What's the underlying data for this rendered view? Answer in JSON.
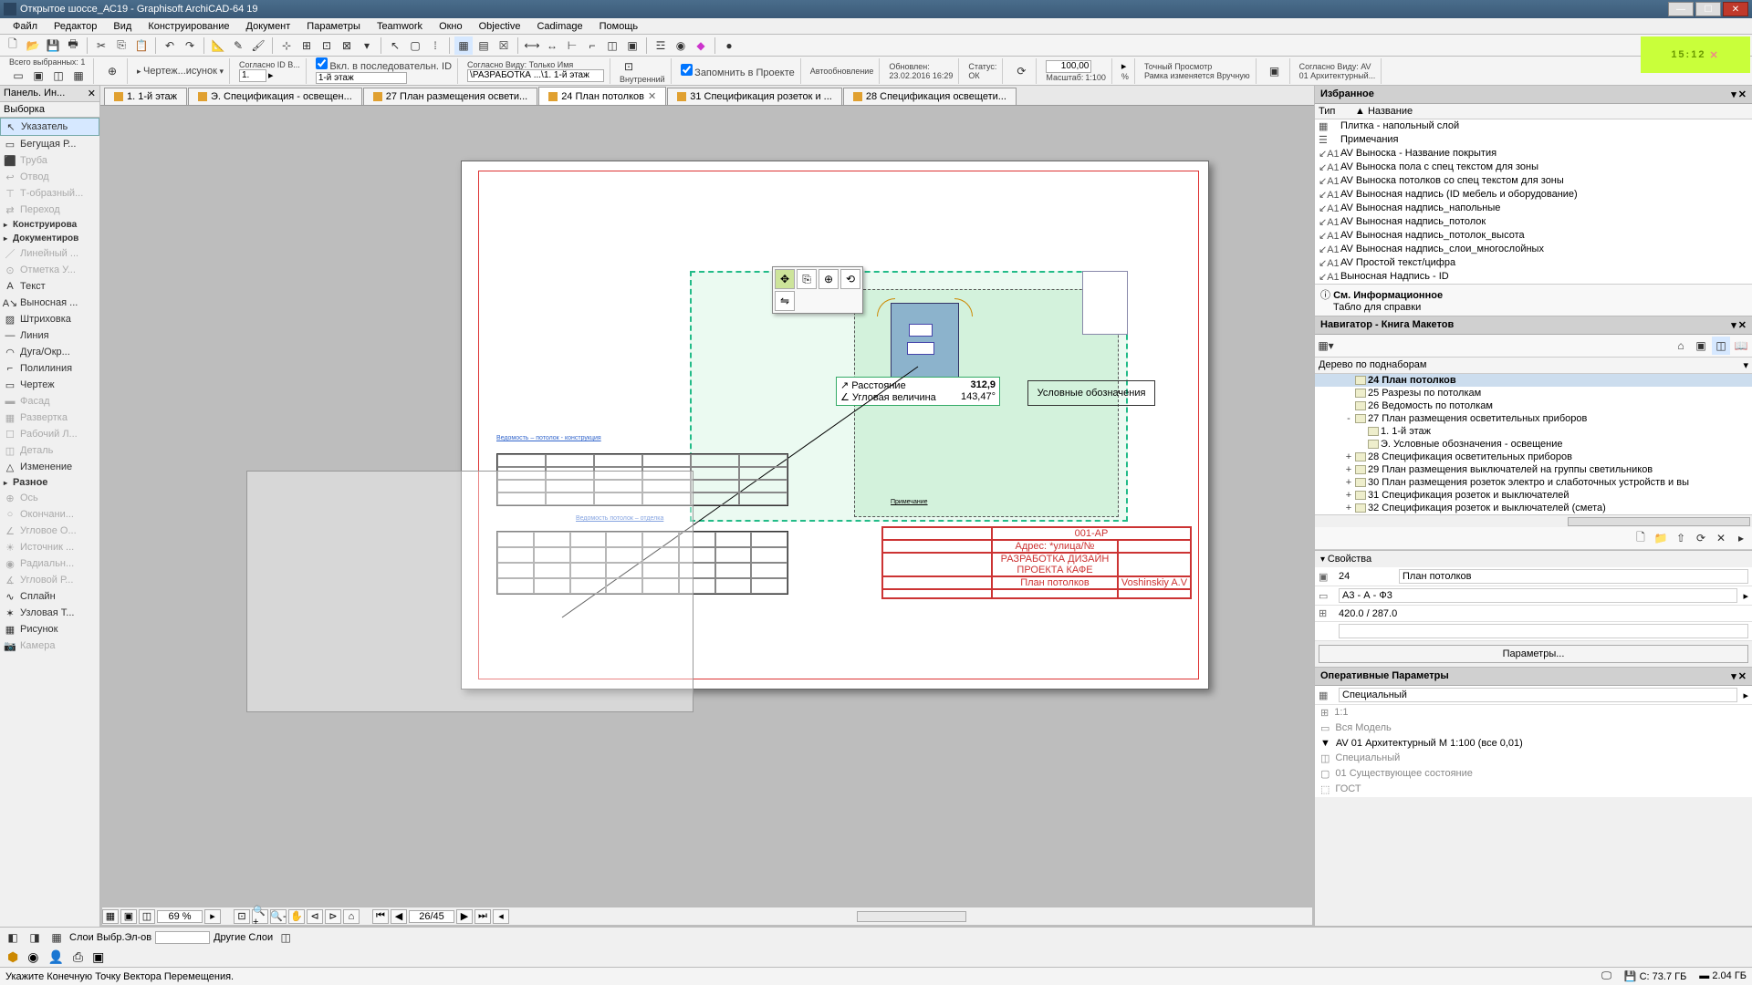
{
  "title": "Открытое шоссе_АС19 - Graphisoft ArchiCAD-64 19",
  "menu": [
    "Файл",
    "Редактор",
    "Вид",
    "Конструирование",
    "Документ",
    "Параметры",
    "Teamwork",
    "Окно",
    "Objective",
    "Cadimage",
    "Помощь"
  ],
  "clock": "15:12",
  "infobar": {
    "sel_label": "Всего выбранных: 1",
    "drawing": "Чертеж...исунок",
    "id_mode_label": "Согласно ID В...",
    "id_val": "1.",
    "seq_label": "Вкл. в последовательн. ID",
    "story": "1-й этаж",
    "view_label": "Согласно Виду: Только Имя",
    "source": "\\РАЗРАБОТКА ...\\1. 1-й этаж",
    "inner": "Внутренний",
    "save": "Запомнить в Проекте",
    "auto": "Автообновление",
    "updated_label": "Обновлен:",
    "updated_val": "23.02.2016 16:29",
    "status_label": "Статус:",
    "status_val": "ОК",
    "size_val": "100,00",
    "pct": "%",
    "scale_label": "Масштаб:",
    "scale_val": "1:100",
    "preview": "Точный Просмотр",
    "frame": "Рамка изменяется Вручную",
    "view_ref_label": "Согласно Виду: AV",
    "view_ref_val": "01 Архитектурный..."
  },
  "toolbox": {
    "title": "Панель. Ин...",
    "subtitle": "Выборка",
    "items": [
      {
        "icon": "↖",
        "label": "Указатель",
        "sel": true
      },
      {
        "icon": "▭",
        "label": "Бегущая Р...",
        "dim": false
      },
      {
        "icon": "⬛",
        "label": "Труба",
        "dim": true
      },
      {
        "icon": "↩",
        "label": "Отвод",
        "dim": true
      },
      {
        "icon": "⊤",
        "label": "Т-образный...",
        "dim": true
      },
      {
        "icon": "⇄",
        "label": "Переход",
        "dim": true
      }
    ],
    "groups": [
      {
        "label": "Конструирова",
        "tri": true
      },
      {
        "label": "Документиров",
        "tri": true
      }
    ],
    "doc_items": [
      {
        "icon": "／",
        "label": "Линейный ...",
        "dim": true
      },
      {
        "icon": "⊙",
        "label": "Отметка У...",
        "dim": true
      },
      {
        "icon": "A",
        "label": "Текст"
      },
      {
        "icon": "A↘",
        "label": "Выносная ..."
      },
      {
        "icon": "▨",
        "label": "Штриховка"
      },
      {
        "icon": "—",
        "label": "Линия"
      },
      {
        "icon": "◠",
        "label": "Дуга/Окр..."
      },
      {
        "icon": "⌐",
        "label": "Полилиния"
      },
      {
        "icon": "▭",
        "label": "Чертеж"
      },
      {
        "icon": "▬",
        "label": "Фасад",
        "dim": true
      },
      {
        "icon": "▦",
        "label": "Развертка",
        "dim": true
      },
      {
        "icon": "☐",
        "label": "Рабочий Л...",
        "dim": true
      },
      {
        "icon": "◫",
        "label": "Деталь",
        "dim": true
      },
      {
        "icon": "△",
        "label": "Изменение"
      }
    ],
    "more_group": "Разное",
    "more_items": [
      {
        "icon": "⊕",
        "label": "Ось",
        "dim": true
      },
      {
        "icon": "○",
        "label": "Окончани...",
        "dim": true
      },
      {
        "icon": "∠",
        "label": "Угловое О...",
        "dim": true
      },
      {
        "icon": "☀",
        "label": "Источник ...",
        "dim": true
      },
      {
        "icon": "◉",
        "label": "Радиальн...",
        "dim": true
      },
      {
        "icon": "∡",
        "label": "Угловой Р...",
        "dim": true
      },
      {
        "icon": "∿",
        "label": "Сплайн"
      },
      {
        "icon": "✶",
        "label": "Узловая Т..."
      },
      {
        "icon": "▦",
        "label": "Рисунок"
      },
      {
        "icon": "📷",
        "label": "Камера",
        "dim": true
      }
    ]
  },
  "tabs": [
    {
      "label": "1. 1-й этаж"
    },
    {
      "label": "Э. Спецификация - освещен..."
    },
    {
      "label": "27 План размещения освети..."
    },
    {
      "label": "24 План потолков",
      "active": true
    },
    {
      "label": "31 Спецификация розеток и ..."
    },
    {
      "label": "28 Спецификация освещети..."
    }
  ],
  "canvas_tooltip": {
    "dist": "Расстояние",
    "dist_val": "312,9",
    "ang": "Угловая величина",
    "ang_val": "143,47°"
  },
  "canvas_labels": {
    "spec1": "Ведомость – потолок - конструкция",
    "spec2": "Ведомость потолок – отделка",
    "note": "Примечание",
    "titleblock": "План потолков",
    "legend": "Условные обозначения",
    "proj": "РАЗРАБОТКА ДИЗАЙН ПРОЕКТА КАФЕ",
    "code": "001-АР",
    "auth": "Voshinskiy A.V",
    "date": "Адрес: *улица/№"
  },
  "zoom": {
    "pct": "69 %",
    "page": "26/45"
  },
  "favorites": {
    "title": "Избранное",
    "cols": [
      "Тип",
      "▲ Название"
    ],
    "rows": [
      {
        "t": "▦",
        "n": "Плитка - напольный слой"
      },
      {
        "t": "☰",
        "n": "Примечания"
      },
      {
        "t": "↙A1",
        "n": "AV Выноска - Название покрытия"
      },
      {
        "t": "↙A1",
        "n": "AV Выноска пола с спец текстом для зоны"
      },
      {
        "t": "↙A1",
        "n": "AV Выноска потолков со спец текстом для зоны"
      },
      {
        "t": "↙A1",
        "n": "AV Выносная надпись (ID мебель и оборудование)"
      },
      {
        "t": "↙A1",
        "n": "AV Выносная надпись_напольные"
      },
      {
        "t": "↙A1",
        "n": "AV Выносная надпись_потолок"
      },
      {
        "t": "↙A1",
        "n": "AV Выносная надпись_потолок_высота"
      },
      {
        "t": "↙A1",
        "n": "AV Выносная надпись_слои_многослойных"
      },
      {
        "t": "↙A1",
        "n": "AV Простой текст/цифра"
      },
      {
        "t": "↙A1",
        "n": "Выносная Надпись - ID"
      }
    ],
    "footer_title": "См. Информационное",
    "footer_sub": "Табло для справки"
  },
  "navigator": {
    "title": "Навигатор - Книга Макетов",
    "filter": "Дерево по поднаборам",
    "tree": [
      {
        "ind": 2,
        "ico": "▣",
        "label": "24 План потолков",
        "sel": true
      },
      {
        "ind": 2,
        "ico": "▣",
        "label": "25 Разрезы по потолкам"
      },
      {
        "ind": 2,
        "ico": "▣",
        "label": "26 Ведомость по потолкам"
      },
      {
        "ind": 2,
        "ico": "▣",
        "label": "27 План размещения осветительных приборов",
        "tog": "-"
      },
      {
        "ind": 3,
        "ico": "▫",
        "label": "1. 1-й этаж"
      },
      {
        "ind": 3,
        "ico": "▫",
        "label": "Э. Условные обозначения - освещение"
      },
      {
        "ind": 2,
        "ico": "▣",
        "label": "28 Спецификация осветительных приборов",
        "tog": "+"
      },
      {
        "ind": 2,
        "ico": "▣",
        "label": "29 План размещения выключателей на группы светильников",
        "tog": "+"
      },
      {
        "ind": 2,
        "ico": "▣",
        "label": "30 План размещения розеток электро и слаботочных устройств и вы",
        "tog": "+"
      },
      {
        "ind": 2,
        "ico": "▣",
        "label": "31 Спецификация розеток и выключателей",
        "tog": "+"
      },
      {
        "ind": 2,
        "ico": "▣",
        "label": "32 Спецификация розеток и выключателей (смета)",
        "tog": "+"
      }
    ]
  },
  "props": {
    "title": "Свойства",
    "id": "24",
    "name": "План потолков",
    "format": "А3 - А - Ф3",
    "dims": "420.0 / 287.0",
    "param_btn": "Параметры..."
  },
  "oper": {
    "title": "Оперативные Параметры",
    "combo": "Специальный",
    "rows": [
      {
        "t": "⊞",
        "n": "1:1",
        "dim": true
      },
      {
        "t": "▭",
        "n": "Вся Модель",
        "dim": true
      },
      {
        "t": "▼",
        "n": "AV 01 Архитектурный М 1:100 (все 0,01)"
      },
      {
        "t": "◫",
        "n": "Специальный",
        "dim": true
      },
      {
        "t": "▢",
        "n": "01 Существующее состояние",
        "dim": true
      },
      {
        "t": "⬚",
        "n": "ГОСТ",
        "dim": true
      }
    ]
  },
  "layers": {
    "l1": "Слои Выбр.Эл-ов",
    "l2": "Другие Слои"
  },
  "status": {
    "hint": "Укажите Конечную Точку Вектора Перемещения.",
    "disk_c": "С: 73.7 ГБ",
    "ram": "2.04 ГБ"
  }
}
